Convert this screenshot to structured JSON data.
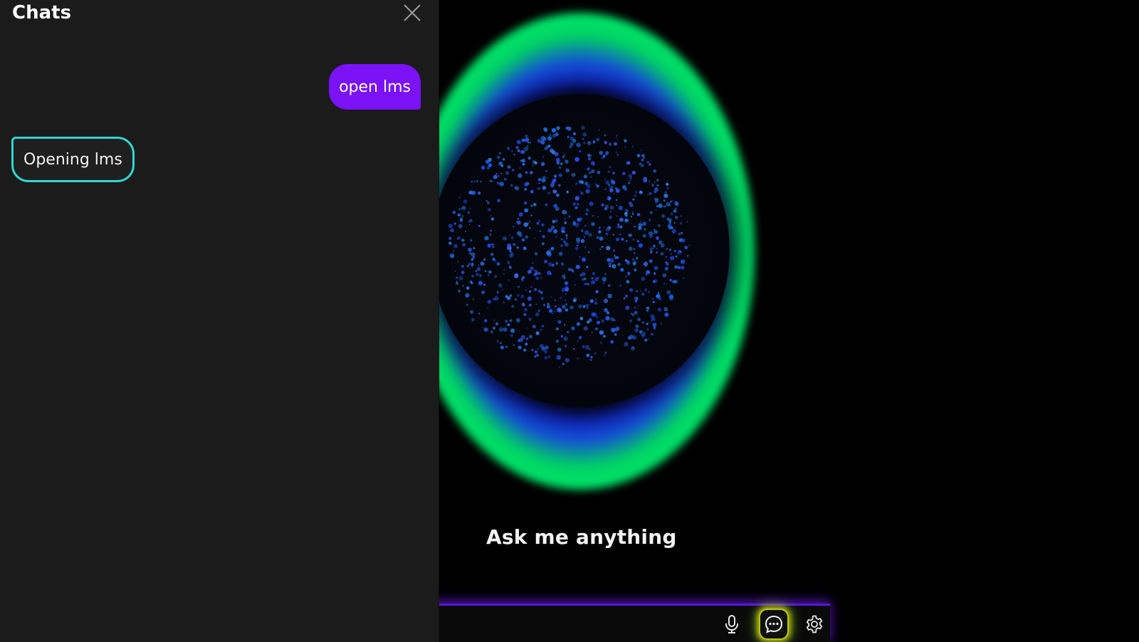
{
  "chat_panel": {
    "title": "Chats",
    "close_icon": "close-icon",
    "messages": [
      {
        "role": "user",
        "text": "open lms"
      },
      {
        "role": "assistant",
        "text": "Opening lms"
      }
    ]
  },
  "stage": {
    "prompt_text": "Ask me anything"
  },
  "controls": {
    "mic_icon": "microphone-icon",
    "chat_icon": "chat-bubble-icon",
    "settings_icon": "gear-icon",
    "active": "chat"
  },
  "colors": {
    "user_bubble": "#7a12f5",
    "assistant_border": "#2fd6d0",
    "ring_green": "#00f06e",
    "ring_blue": "#1450d2",
    "bar_accent": "#5a14d8",
    "active_glow": "#b7c51b"
  }
}
